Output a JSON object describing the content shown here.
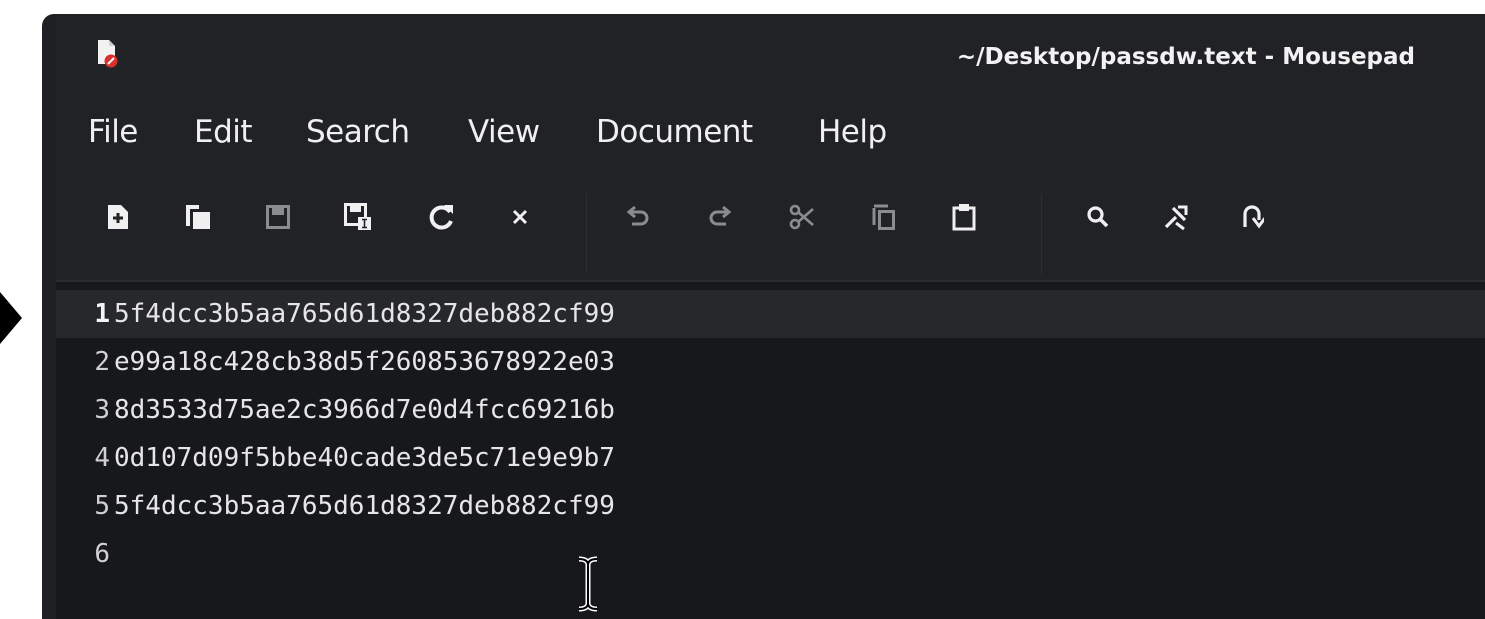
{
  "window": {
    "title": "~/Desktop/passdw.text - Mousepad"
  },
  "menu": {
    "items": [
      "File",
      "Edit",
      "Search",
      "View",
      "Document",
      "Help"
    ]
  },
  "toolbar": {
    "buttons": [
      {
        "icon": "new-document-icon"
      },
      {
        "icon": "new-window-icon"
      },
      {
        "icon": "save-icon"
      },
      {
        "icon": "save-as-icon"
      },
      {
        "icon": "reload-icon"
      },
      {
        "icon": "close-icon"
      },
      {
        "icon": "undo-icon"
      },
      {
        "icon": "redo-icon"
      },
      {
        "icon": "cut-icon"
      },
      {
        "icon": "copy-icon"
      },
      {
        "icon": "paste-icon"
      },
      {
        "icon": "search-icon"
      },
      {
        "icon": "search-replace-icon"
      },
      {
        "icon": "go-to-line-icon"
      }
    ]
  },
  "editor": {
    "lines": [
      {
        "number": "1",
        "text": "5f4dcc3b5aa765d61d8327deb882cf99"
      },
      {
        "number": "2",
        "text": "e99a18c428cb38d5f260853678922e03"
      },
      {
        "number": "3",
        "text": "8d3533d75ae2c3966d7e0d4fcc69216b"
      },
      {
        "number": "4",
        "text": "0d107d09f5bbe40cade3de5c71e9e9b7"
      },
      {
        "number": "5",
        "text": "5f4dcc3b5aa765d61d8327deb882cf99"
      },
      {
        "number": "6",
        "text": ""
      }
    ],
    "current_line": 1
  },
  "colors": {
    "window_bg": "#202226",
    "editor_bg": "#17181b",
    "current_line_bg": "#26282c",
    "text": "#e6e6e6",
    "app_icon_badge": "#d9302c"
  }
}
